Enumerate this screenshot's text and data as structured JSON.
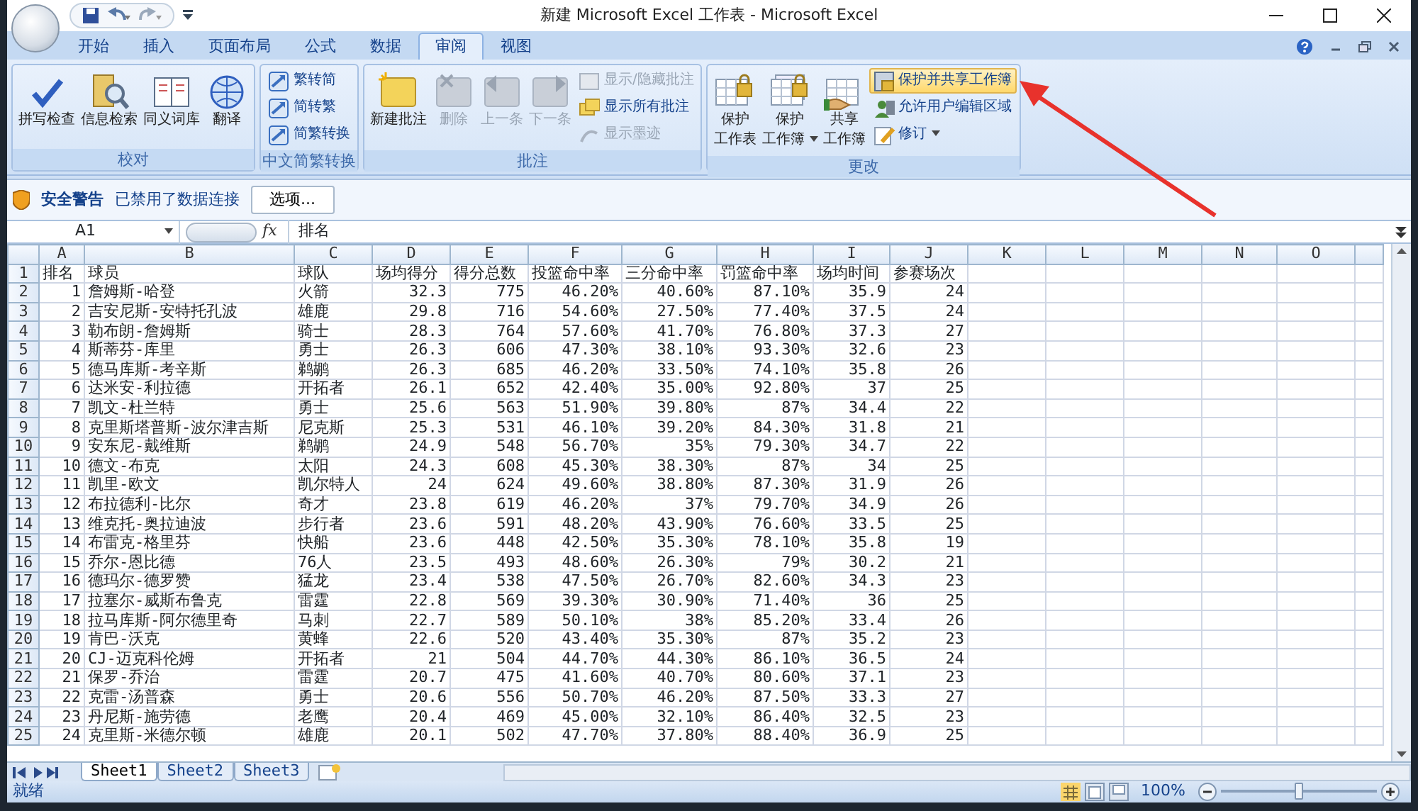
{
  "window": {
    "title": "新建 Microsoft Excel 工作表 - Microsoft Excel"
  },
  "tabs": [
    {
      "label": "开始",
      "selected": false
    },
    {
      "label": "插入",
      "selected": false
    },
    {
      "label": "页面布局",
      "selected": false
    },
    {
      "label": "公式",
      "selected": false
    },
    {
      "label": "数据",
      "selected": false
    },
    {
      "label": "审阅",
      "selected": true
    },
    {
      "label": "视图",
      "selected": false
    }
  ],
  "ribbon": {
    "groups": [
      {
        "title": "校对",
        "items": [
          {
            "label": "拼写检查",
            "kind": "large",
            "disabled": false,
            "highlighted": false
          },
          {
            "label": "信息检索",
            "kind": "large",
            "disabled": false,
            "highlighted": false
          },
          {
            "label": "同义词库",
            "kind": "large",
            "disabled": false,
            "highlighted": false
          },
          {
            "label": "翻译",
            "kind": "large",
            "disabled": false,
            "highlighted": false
          }
        ]
      },
      {
        "title": "中文简繁转换",
        "items": [
          {
            "label": "繁转简",
            "kind": "small",
            "disabled": false,
            "highlighted": false
          },
          {
            "label": "简转繁",
            "kind": "small",
            "disabled": false,
            "highlighted": false
          },
          {
            "label": "简繁转换",
            "kind": "small",
            "disabled": false,
            "highlighted": false
          }
        ]
      },
      {
        "title": "批注",
        "items": [
          {
            "label": "新建批注",
            "kind": "large",
            "disabled": false,
            "highlighted": false
          },
          {
            "label": "删除",
            "kind": "large",
            "disabled": true,
            "highlighted": false
          },
          {
            "label": "上一条",
            "kind": "large",
            "disabled": true,
            "highlighted": false
          },
          {
            "label": "下一条",
            "kind": "large",
            "disabled": true,
            "highlighted": false
          },
          {
            "label": "显示/隐藏批注",
            "kind": "small",
            "disabled": true,
            "highlighted": false
          },
          {
            "label": "显示所有批注",
            "kind": "small",
            "disabled": false,
            "highlighted": false
          },
          {
            "label": "显示墨迹",
            "kind": "small",
            "disabled": true,
            "highlighted": false
          }
        ]
      },
      {
        "title": "更改",
        "items": [
          {
            "lines": [
              "保护",
              "工作表"
            ],
            "kind": "large",
            "disabled": false,
            "highlighted": false
          },
          {
            "lines": [
              "保护",
              "工作簿"
            ],
            "kind": "large",
            "disabled": false,
            "highlighted": false,
            "dropdown": true
          },
          {
            "lines": [
              "共享",
              "工作簿"
            ],
            "kind": "large",
            "disabled": false,
            "highlighted": false
          },
          {
            "label": "保护并共享工作簿",
            "kind": "small",
            "disabled": false,
            "highlighted": true
          },
          {
            "label": "允许用户编辑区域",
            "kind": "small",
            "disabled": false,
            "highlighted": false
          },
          {
            "label": "修订",
            "kind": "small",
            "disabled": false,
            "highlighted": false,
            "dropdown": true
          }
        ]
      }
    ]
  },
  "security_bar": {
    "title": "安全警告",
    "message": "已禁用了数据连接",
    "button": "选项..."
  },
  "formula_bar": {
    "name_box": "A1",
    "fx": "fx",
    "formula": "排名"
  },
  "sheet": {
    "column_letters": [
      "A",
      "B",
      "C",
      "D",
      "E",
      "F",
      "G",
      "H",
      "I",
      "J",
      "K",
      "L",
      "M",
      "N",
      "O"
    ],
    "header": {
      "number": "1",
      "cells": [
        "排名",
        "球员",
        "球队",
        "场均得分",
        "得分总数",
        "投篮命中率",
        "三分命中率",
        "罚篮命中率",
        "场均时间",
        "参赛场次"
      ]
    },
    "rows": [
      {
        "number": "2",
        "cells": [
          "1",
          "詹姆斯-哈登",
          "火箭",
          "32.3",
          "775",
          "46.20%",
          "40.60%",
          "87.10%",
          "35.9",
          "24"
        ]
      },
      {
        "number": "3",
        "cells": [
          "2",
          "吉安尼斯-安特托孔波",
          "雄鹿",
          "29.8",
          "716",
          "54.60%",
          "27.50%",
          "77.40%",
          "37.5",
          "24"
        ]
      },
      {
        "number": "4",
        "cells": [
          "3",
          "勒布朗-詹姆斯",
          "骑士",
          "28.3",
          "764",
          "57.60%",
          "41.70%",
          "76.80%",
          "37.3",
          "27"
        ]
      },
      {
        "number": "5",
        "cells": [
          "4",
          "斯蒂芬-库里",
          "勇士",
          "26.3",
          "606",
          "47.30%",
          "38.10%",
          "93.30%",
          "32.6",
          "23"
        ]
      },
      {
        "number": "6",
        "cells": [
          "5",
          "德马库斯-考辛斯",
          "鹈鹕",
          "26.3",
          "685",
          "46.20%",
          "33.50%",
          "74.10%",
          "35.8",
          "26"
        ]
      },
      {
        "number": "7",
        "cells": [
          "6",
          "达米安-利拉德",
          "开拓者",
          "26.1",
          "652",
          "42.40%",
          "35.00%",
          "92.80%",
          "37",
          "25"
        ]
      },
      {
        "number": "8",
        "cells": [
          "7",
          "凯文-杜兰特",
          "勇士",
          "25.6",
          "563",
          "51.90%",
          "39.80%",
          "87%",
          "34.4",
          "22"
        ]
      },
      {
        "number": "9",
        "cells": [
          "8",
          "克里斯塔普斯-波尔津吉斯",
          "尼克斯",
          "25.3",
          "531",
          "46.10%",
          "39.20%",
          "84.30%",
          "31.8",
          "21"
        ]
      },
      {
        "number": "10",
        "cells": [
          "9",
          "安东尼-戴维斯",
          "鹈鹕",
          "24.9",
          "548",
          "56.70%",
          "35%",
          "79.30%",
          "34.7",
          "22"
        ]
      },
      {
        "number": "11",
        "cells": [
          "10",
          "德文-布克",
          "太阳",
          "24.3",
          "608",
          "45.30%",
          "38.30%",
          "87%",
          "34",
          "25"
        ]
      },
      {
        "number": "12",
        "cells": [
          "11",
          "凯里-欧文",
          "凯尔特人",
          "24",
          "624",
          "49.60%",
          "38.80%",
          "87.30%",
          "31.9",
          "26"
        ]
      },
      {
        "number": "13",
        "cells": [
          "12",
          "布拉德利-比尔",
          "奇才",
          "23.8",
          "619",
          "46.20%",
          "37%",
          "79.70%",
          "34.9",
          "26"
        ]
      },
      {
        "number": "14",
        "cells": [
          "13",
          "维克托-奥拉迪波",
          "步行者",
          "23.6",
          "591",
          "48.20%",
          "43.90%",
          "76.60%",
          "33.5",
          "25"
        ]
      },
      {
        "number": "15",
        "cells": [
          "14",
          "布雷克-格里芬",
          "快船",
          "23.6",
          "448",
          "42.50%",
          "35.30%",
          "78.10%",
          "35.8",
          "19"
        ]
      },
      {
        "number": "16",
        "cells": [
          "15",
          "乔尔-恩比德",
          "76人",
          "23.5",
          "493",
          "48.60%",
          "26.30%",
          "79%",
          "30.2",
          "21"
        ]
      },
      {
        "number": "17",
        "cells": [
          "16",
          "德玛尔-德罗赞",
          "猛龙",
          "23.4",
          "538",
          "47.50%",
          "26.70%",
          "82.60%",
          "34.3",
          "23"
        ]
      },
      {
        "number": "18",
        "cells": [
          "17",
          "拉塞尔-威斯布鲁克",
          "雷霆",
          "22.8",
          "569",
          "39.30%",
          "30.90%",
          "71.40%",
          "36",
          "25"
        ]
      },
      {
        "number": "19",
        "cells": [
          "18",
          "拉马库斯-阿尔德里奇",
          "马刺",
          "22.7",
          "589",
          "50.10%",
          "38%",
          "85.20%",
          "33.4",
          "26"
        ]
      },
      {
        "number": "20",
        "cells": [
          "19",
          "肯巴-沃克",
          "黄蜂",
          "22.6",
          "520",
          "43.40%",
          "35.30%",
          "87%",
          "35.2",
          "23"
        ]
      },
      {
        "number": "21",
        "cells": [
          "20",
          "CJ-迈克科伦姆",
          "开拓者",
          "21",
          "504",
          "44.70%",
          "44.30%",
          "86.10%",
          "36.5",
          "24"
        ]
      },
      {
        "number": "22",
        "cells": [
          "21",
          "保罗-乔治",
          "雷霆",
          "20.7",
          "475",
          "41.60%",
          "40.70%",
          "80.60%",
          "37.1",
          "23"
        ]
      },
      {
        "number": "23",
        "cells": [
          "22",
          "克雷-汤普森",
          "勇士",
          "20.6",
          "556",
          "50.70%",
          "46.20%",
          "87.50%",
          "33.3",
          "27"
        ]
      },
      {
        "number": "24",
        "cells": [
          "23",
          "丹尼斯-施劳德",
          "老鹰",
          "20.4",
          "469",
          "45.00%",
          "32.10%",
          "86.40%",
          "32.5",
          "23"
        ]
      },
      {
        "number": "25",
        "cells": [
          "24",
          "克里斯-米德尔顿",
          "雄鹿",
          "20.1",
          "502",
          "47.70%",
          "37.80%",
          "88.40%",
          "36.9",
          "25"
        ]
      }
    ]
  },
  "sheet_tabs": [
    {
      "label": "Sheet1",
      "selected": true
    },
    {
      "label": "Sheet2",
      "selected": false
    },
    {
      "label": "Sheet3",
      "selected": false
    }
  ],
  "status_bar": {
    "status": "就绪",
    "zoom": {
      "reading": "100%",
      "level": 0.5
    }
  }
}
